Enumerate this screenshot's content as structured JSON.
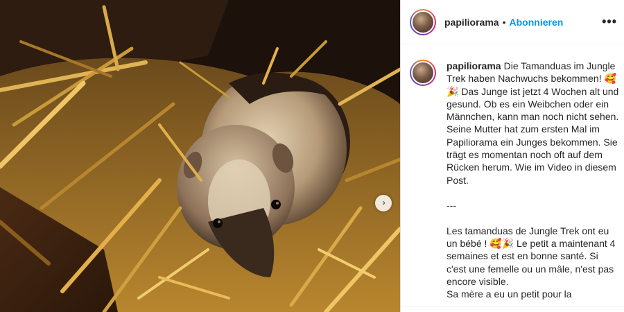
{
  "media": {
    "description_icon": "image-slide",
    "next_icon": "chevron-right-icon",
    "next_glyph": "›"
  },
  "header": {
    "username": "papiliorama",
    "separator": "•",
    "follow_label": "Abonnieren",
    "more_glyph": "•••"
  },
  "caption": {
    "username": "papiliorama",
    "text": "Die Tamanduas im Jungle Trek haben Nachwuchs bekommen! 🥰🎉 Das Junge ist jetzt 4 Wochen alt und gesund. Ob es ein Weibchen oder ein Männchen, kann man noch nicht sehen.\nSeine Mutter hat zum ersten Mal im Papiliorama ein Junges bekommen. Sie trägt es momentan noch oft auf dem Rücken herum. Wie im Video in diesem Post.\n\n---\n\nLes tamanduas de Jungle Trek ont eu un bébé ! 🥰🎉 Le petit a maintenant 4 semaines et est en bonne santé. Si c'est une femelle ou un mâle, n'est pas encore visible.\nSa mère a eu un petit pour la"
  },
  "colors": {
    "accent": "#0095f6",
    "text": "#262626",
    "border": "#dbdbdb"
  }
}
